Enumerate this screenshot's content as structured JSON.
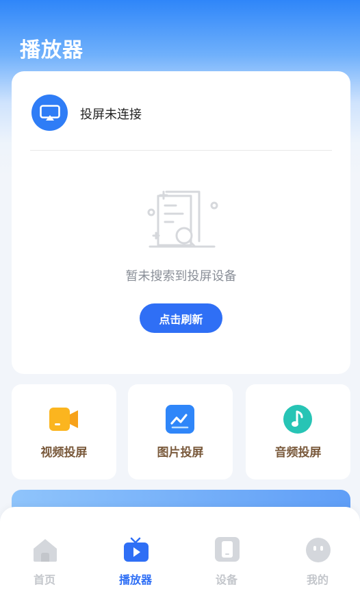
{
  "header": {
    "title": "播放器"
  },
  "cast": {
    "status": "投屏未连接",
    "empty_message": "暂未搜索到投屏设备",
    "refresh_label": "点击刷新"
  },
  "features": [
    {
      "label": "视频投屏",
      "icon": "video-camera-icon",
      "color": "#fbb51f"
    },
    {
      "label": "图片投屏",
      "icon": "image-icon",
      "color": "#2f86f9"
    },
    {
      "label": "音频投屏",
      "icon": "music-note-icon",
      "color": "#27c4b5"
    }
  ],
  "tabs": [
    {
      "label": "首页",
      "icon": "home-icon",
      "active": false
    },
    {
      "label": "播放器",
      "icon": "tv-play-icon",
      "active": true
    },
    {
      "label": "设备",
      "icon": "phone-device-icon",
      "active": false
    },
    {
      "label": "我的",
      "icon": "profile-face-icon",
      "active": false
    }
  ],
  "colors": {
    "accent": "#2f6ff5",
    "inactive_tab": "#c3c6cb",
    "feature_label": "#7a5a3c"
  }
}
